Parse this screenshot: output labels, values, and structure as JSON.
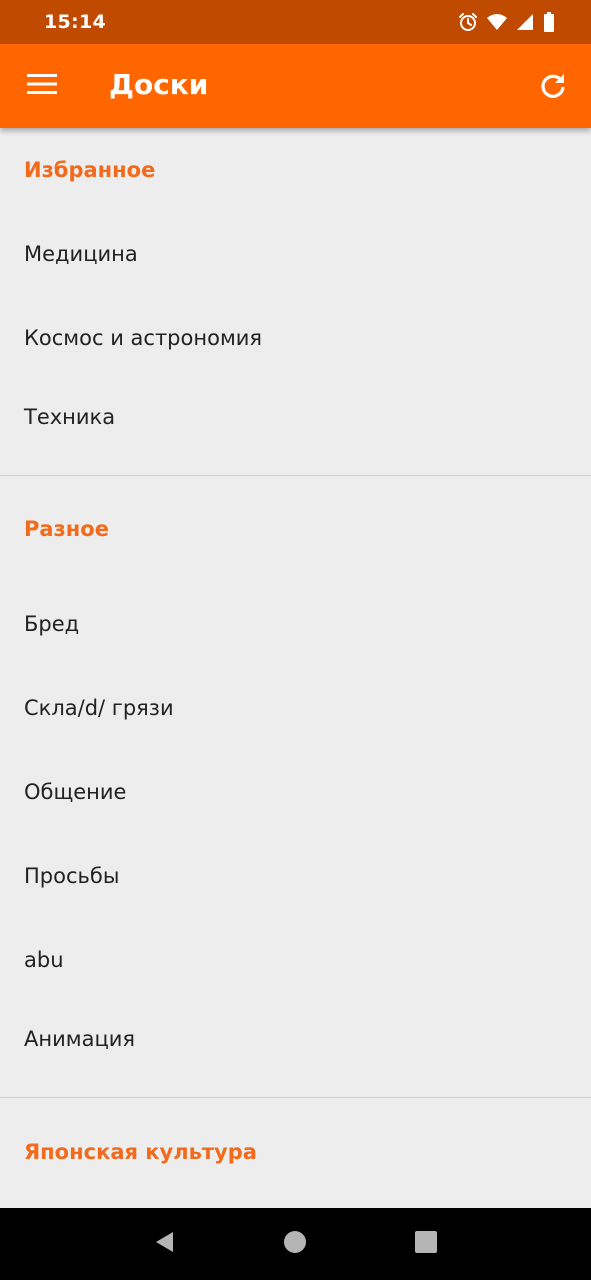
{
  "status_bar": {
    "time": "15:14",
    "icons": [
      "alarm-icon",
      "wifi-icon",
      "signal-icon",
      "battery-icon"
    ]
  },
  "app_bar": {
    "title": "Доски",
    "menu_icon": "menu-icon",
    "refresh_icon": "refresh-icon",
    "background": "#ff6600"
  },
  "sections": [
    {
      "header": "Избранное",
      "items": [
        "Медицина",
        "Космос и астрономия",
        "Техника"
      ]
    },
    {
      "header": "Разное",
      "items": [
        "Бред",
        "Скла/d/ грязи",
        "Общение",
        "Просьбы",
        "abu",
        "Анимация"
      ]
    },
    {
      "header": "Японская культура",
      "items": []
    }
  ],
  "nav_bar": {
    "buttons": [
      "back-icon",
      "home-icon",
      "recents-icon"
    ]
  },
  "colors": {
    "accent": "#f26a1b",
    "status_bar": "#c04a00",
    "background": "#ededed"
  }
}
